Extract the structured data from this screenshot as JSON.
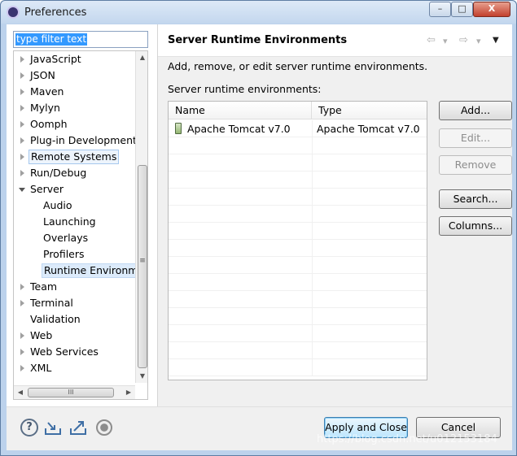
{
  "window": {
    "title": "Preferences",
    "min_glyph": "–",
    "max_glyph": "□",
    "close_glyph": "X"
  },
  "filter": {
    "value": "type filter text"
  },
  "tree": {
    "items": [
      {
        "label": "JavaScript",
        "level": 0,
        "state": "closed"
      },
      {
        "label": "JSON",
        "level": 0,
        "state": "closed"
      },
      {
        "label": "Maven",
        "level": 0,
        "state": "closed"
      },
      {
        "label": "Mylyn",
        "level": 0,
        "state": "closed"
      },
      {
        "label": "Oomph",
        "level": 0,
        "state": "closed"
      },
      {
        "label": "Plug-in Development",
        "level": 0,
        "state": "closed"
      },
      {
        "label": "Remote Systems",
        "level": 0,
        "state": "closed",
        "style": "hover"
      },
      {
        "label": "Run/Debug",
        "level": 0,
        "state": "closed"
      },
      {
        "label": "Server",
        "level": 0,
        "state": "open"
      },
      {
        "label": "Audio",
        "level": 1,
        "state": "none"
      },
      {
        "label": "Launching",
        "level": 1,
        "state": "none"
      },
      {
        "label": "Overlays",
        "level": 1,
        "state": "none"
      },
      {
        "label": "Profilers",
        "level": 1,
        "state": "none"
      },
      {
        "label": "Runtime Environme",
        "level": 1,
        "state": "none",
        "style": "sel"
      },
      {
        "label": "Team",
        "level": 0,
        "state": "closed"
      },
      {
        "label": "Terminal",
        "level": 0,
        "state": "closed"
      },
      {
        "label": "Validation",
        "level": 0,
        "state": "none"
      },
      {
        "label": "Web",
        "level": 0,
        "state": "closed"
      },
      {
        "label": "Web Services",
        "level": 0,
        "state": "closed"
      },
      {
        "label": "XML",
        "level": 0,
        "state": "closed"
      }
    ],
    "scroll_up_glyph": "▲",
    "scroll_down_glyph": "▼",
    "scroll_left_glyph": "◀",
    "scroll_right_glyph": "▶",
    "hthumb_grip": "III",
    "vthumb_grip": "≡"
  },
  "page": {
    "title": "Server Runtime Environments",
    "back_glyph": "⇦",
    "forward_glyph": "⇨",
    "dropdown_glyph": "▾",
    "menu_glyph": "▼",
    "description": "Add, remove, or edit server runtime environments.",
    "list_label": "Server runtime environments:",
    "columns": [
      "Name",
      "Type"
    ],
    "rows": [
      {
        "name": "Apache Tomcat v7.0",
        "type": "Apache Tomcat v7.0"
      }
    ],
    "buttons": {
      "add": "Add...",
      "edit": "Edit...",
      "remove": "Remove",
      "search": "Search...",
      "columns": "Columns..."
    }
  },
  "footer": {
    "help_glyph": "?",
    "apply_close": "Apply and Close",
    "cancel": "Cancel"
  },
  "watermark": "https://blog.csdn.net/u012153184"
}
